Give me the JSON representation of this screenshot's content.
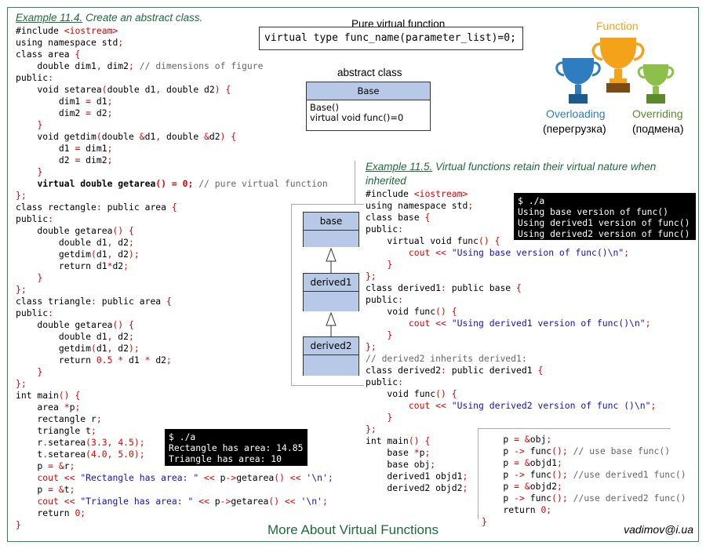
{
  "example1": {
    "title_num": "Example 11.4.",
    "title_rest": " Create an abstract class."
  },
  "example2": {
    "title_num": "Example 11.5.",
    "title_rest": " Virtual functions retain their virtual nature when",
    "title_rest2": "inherited"
  },
  "pure_virtual": {
    "label": "Pure virtual function",
    "code": "virtual type func_name(parameter_list)=0;"
  },
  "abstract_class": {
    "label": "abstract class",
    "name": "Base",
    "members": [
      "Base()",
      "virtual void func()=0"
    ]
  },
  "trophies": {
    "function_label": "Function",
    "overloading_label": "Overloading",
    "overloading_ru": "(перегрузка)",
    "overriding_label": "Overriding",
    "overriding_ru": "(подмена)",
    "colors": {
      "function": "#f5a21b",
      "overloading": "#2e7dc0",
      "overriding": "#8cc04b"
    }
  },
  "hierarchy": [
    "base",
    "derived1",
    "derived2"
  ],
  "terminal1": [
    "$ ./a",
    "Rectangle has area: 14.85",
    "Triangle has area: 10"
  ],
  "terminal2": [
    "$ ./a",
    "Using base version of func()",
    "Using derived1 version of func()",
    "Using derived2 version of func()"
  ],
  "footer": {
    "title": "More About Virtual Functions",
    "email": "vadimov@i.ua"
  }
}
